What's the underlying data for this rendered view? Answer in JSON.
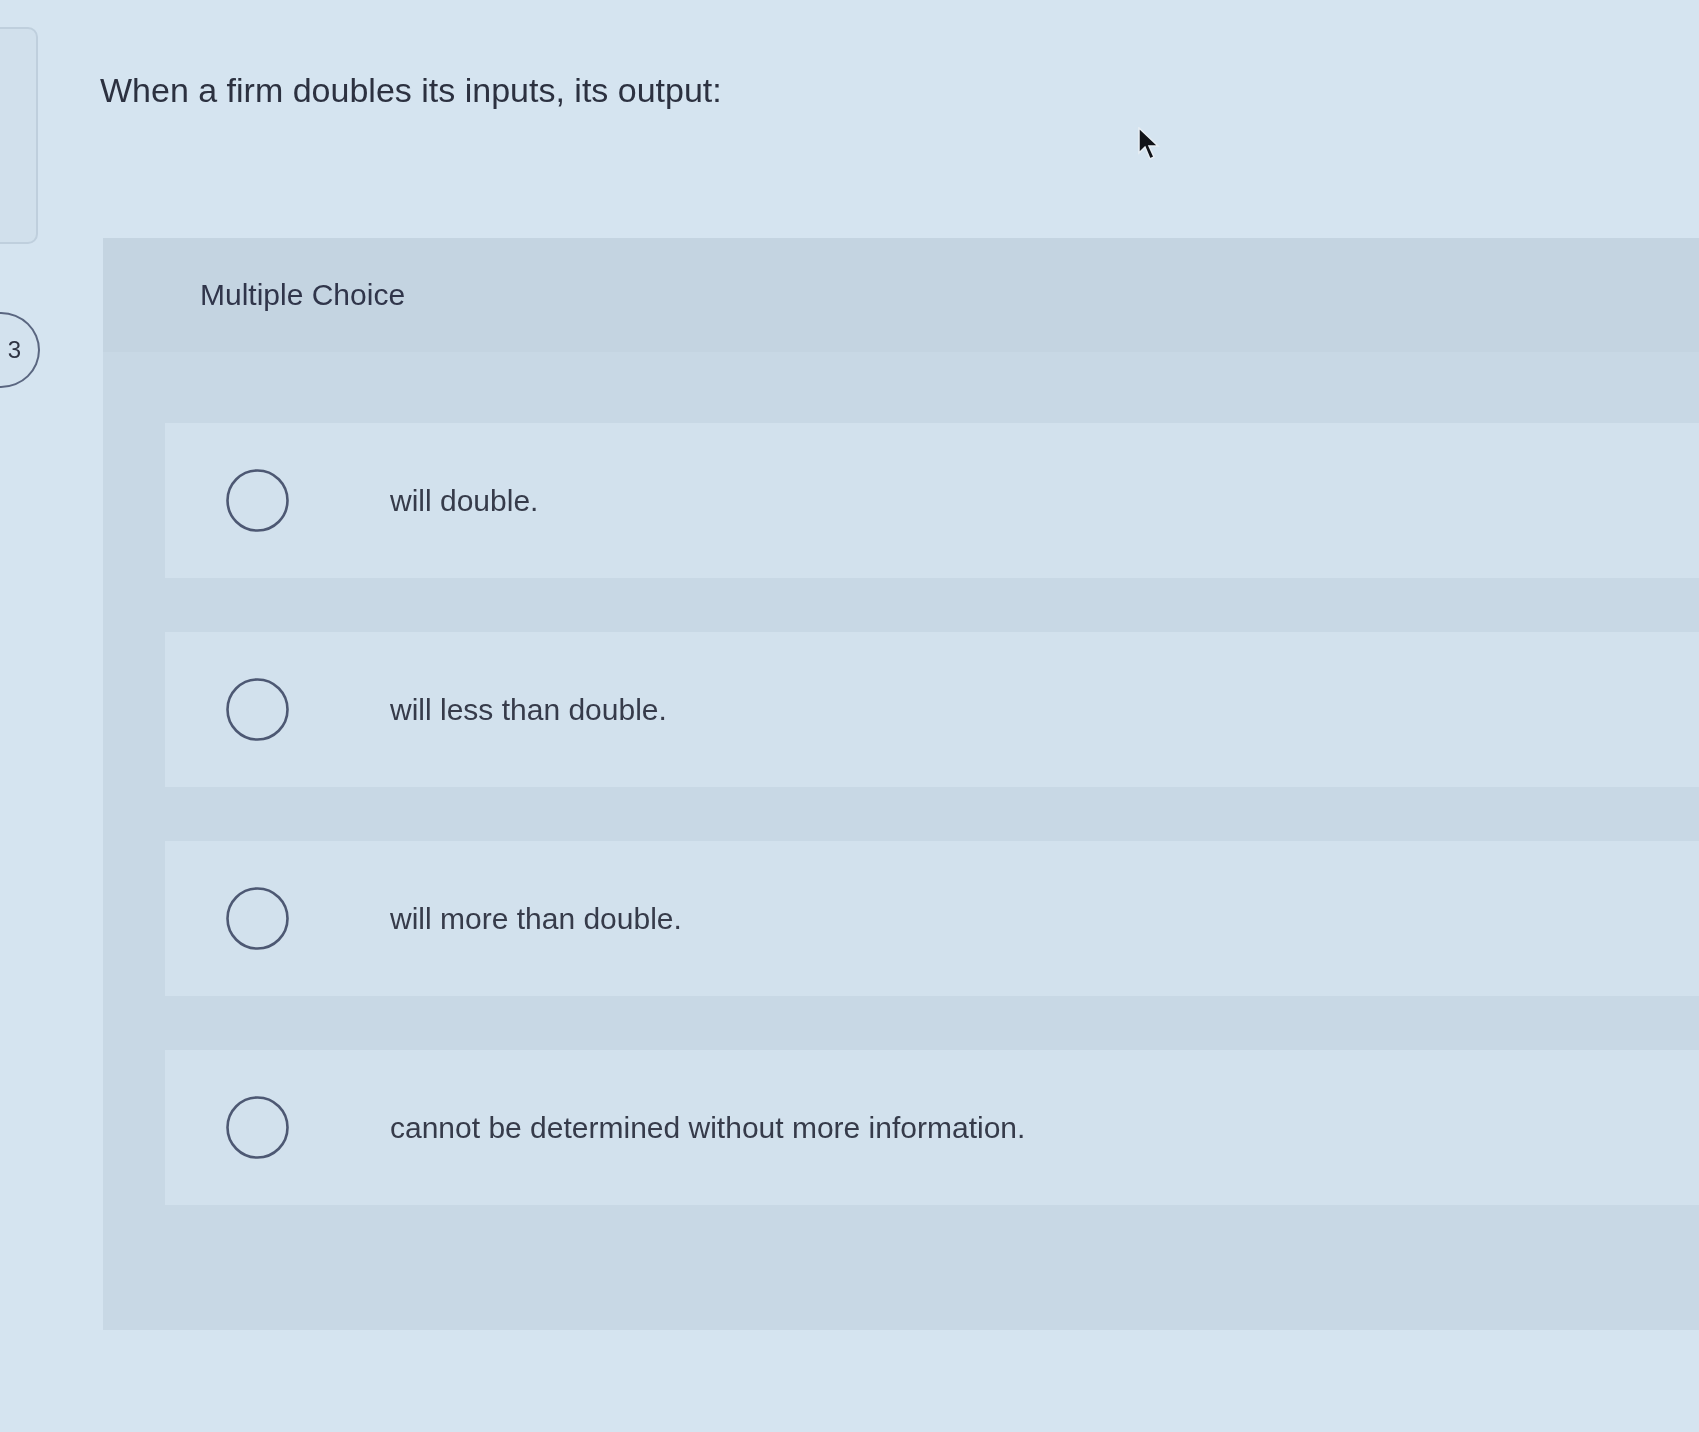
{
  "question": {
    "text": "When a firm doubles its inputs, its output:"
  },
  "question_badge": {
    "text": "3"
  },
  "answer_panel": {
    "title": "Multiple Choice",
    "options": [
      {
        "label": "will double.",
        "selected": false
      },
      {
        "label": "will less than double.",
        "selected": false
      },
      {
        "label": "will more than double.",
        "selected": false
      },
      {
        "label": "cannot be determined without more information.",
        "selected": false
      }
    ]
  }
}
